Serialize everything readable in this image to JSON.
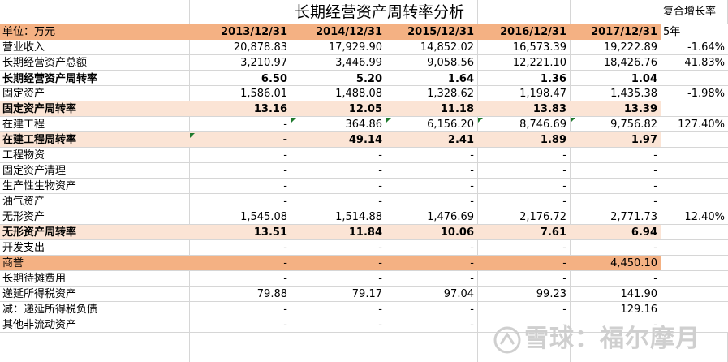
{
  "title": "长期经营资产周转率分析",
  "side_title": "复合增长率",
  "header": {
    "unit_label": "单位：万元",
    "years": [
      "2013/12/31",
      "2014/12/31",
      "2015/12/31",
      "2016/12/31",
      "2017/12/31"
    ],
    "growth_label": "5年"
  },
  "rows": [
    {
      "label": "营业收入",
      "values": [
        "20,878.83",
        "17,929.90",
        "14,852.02",
        "16,573.39",
        "19,222.89"
      ],
      "growth": "-1.64%"
    },
    {
      "label": "长期经营资产总额",
      "values": [
        "3,210.97",
        "3,446.99",
        "9,058.56",
        "12,221.10",
        "18,426.76"
      ],
      "growth": "41.83%"
    },
    {
      "label": "长期经营资产周转率",
      "values": [
        "6.50",
        "5.20",
        "1.64",
        "1.36",
        "1.04"
      ],
      "growth": ""
    },
    {
      "label": "固定资产",
      "values": [
        "1,586.01",
        "1,488.08",
        "1,328.62",
        "1,198.47",
        "1,435.38"
      ],
      "growth": "-1.98%"
    },
    {
      "label": "固定资产周转率",
      "values": [
        "13.16",
        "12.05",
        "11.18",
        "13.83",
        "13.39"
      ],
      "growth": ""
    },
    {
      "label": "在建工程",
      "values": [
        "-",
        "364.86",
        "6,156.20",
        "8,746.69",
        "9,756.82"
      ],
      "growth": "127.40%"
    },
    {
      "label": "在建工程周转率",
      "values": [
        "-",
        "49.14",
        "2.41",
        "1.89",
        "1.97"
      ],
      "growth": ""
    },
    {
      "label": "工程物资",
      "values": [
        "-",
        "-",
        "-",
        "-",
        "-"
      ],
      "growth": ""
    },
    {
      "label": "固定资产清理",
      "values": [
        "-",
        "-",
        "-",
        "-",
        "-"
      ],
      "growth": ""
    },
    {
      "label": "生产性生物资产",
      "values": [
        "-",
        "-",
        "-",
        "-",
        "-"
      ],
      "growth": ""
    },
    {
      "label": "油气资产",
      "values": [
        "-",
        "-",
        "-",
        "-",
        "-"
      ],
      "growth": ""
    },
    {
      "label": "无形资产",
      "values": [
        "1,545.08",
        "1,514.88",
        "1,476.69",
        "2,176.72",
        "2,771.73"
      ],
      "growth": "12.40%"
    },
    {
      "label": "无形资产周转率",
      "values": [
        "13.51",
        "11.84",
        "10.06",
        "7.61",
        "6.94"
      ],
      "growth": ""
    },
    {
      "label": "开发支出",
      "values": [
        "-",
        "-",
        "-",
        "-",
        "-"
      ],
      "growth": ""
    },
    {
      "label": "商誉",
      "values": [
        "-",
        "-",
        "-",
        "-",
        "4,450.10"
      ],
      "growth": ""
    },
    {
      "label": "长期待摊费用",
      "values": [
        "-",
        "-",
        "-",
        "-",
        "-"
      ],
      "growth": ""
    },
    {
      "label": "递延所得税资产",
      "values": [
        "79.88",
        "79.17",
        "97.04",
        "99.23",
        "141.90"
      ],
      "growth": ""
    },
    {
      "label": "减：递延所得税负债",
      "values": [
        "-",
        "-",
        "-",
        "-",
        "129.16"
      ],
      "growth": ""
    },
    {
      "label": "其他非流动资产",
      "values": [
        "-",
        "-",
        "-",
        "-",
        "-"
      ],
      "growth": ""
    }
  ],
  "watermark": "雪球：福尔摩月",
  "colors": {
    "header_orange": "#f4b183",
    "peach": "#fbe4d5",
    "comment_marker": "#1f7a2e"
  }
}
